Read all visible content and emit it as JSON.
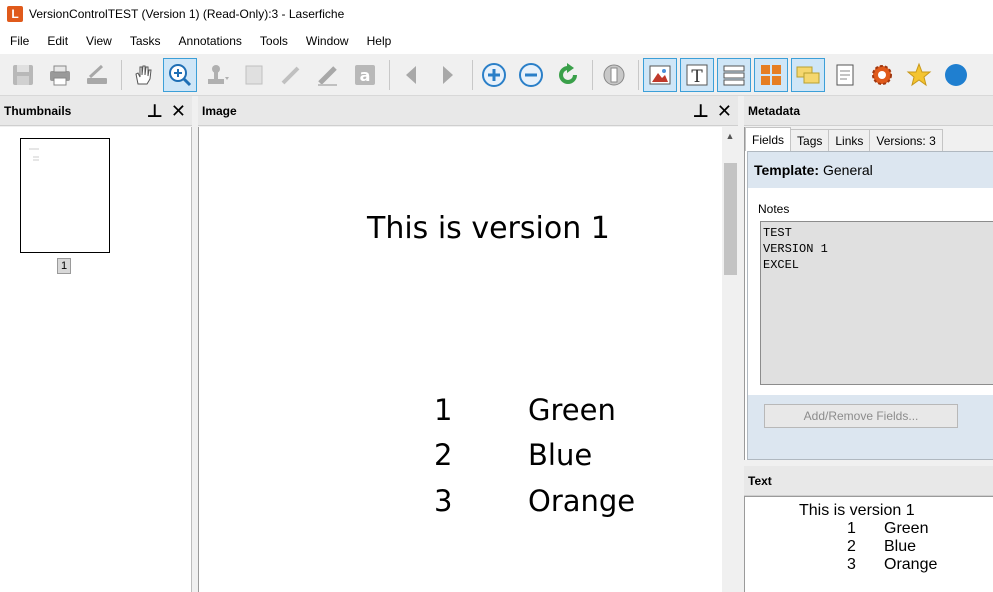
{
  "window": {
    "title": "VersionControlTEST (Version 1) (Read-Only):3 - Laserfiche",
    "app_icon_letter": "L"
  },
  "menu": [
    "File",
    "Edit",
    "View",
    "Tasks",
    "Annotations",
    "Tools",
    "Window",
    "Help"
  ],
  "toolbar": {
    "icons": [
      "save-icon",
      "print-icon",
      "scanner-icon",
      "pan-hand-icon",
      "zoom-marquee-icon",
      "stamp-icon",
      "sticky-note-icon",
      "pen-icon",
      "highlighter-icon",
      "text-box-icon",
      "previous-page-icon",
      "next-page-icon",
      "zoom-in-icon",
      "zoom-out-icon",
      "refresh-icon",
      "thumbnail-view-icon",
      "image-pane-icon",
      "text-pane-icon",
      "metadata-pane-icon",
      "thumbnails-pane-icon",
      "annotations-pane-icon",
      "document-properties-icon",
      "settings-icon",
      "favorites-star-icon",
      "help-icon"
    ]
  },
  "thumbnails": {
    "header": "Thumbnails",
    "page_number": "1"
  },
  "image": {
    "header": "Image",
    "title": "This is version 1",
    "rows": [
      {
        "num": "1",
        "label": "Green"
      },
      {
        "num": "2",
        "label": "Blue"
      },
      {
        "num": "3",
        "label": "Orange"
      }
    ]
  },
  "metadata": {
    "header": "Metadata",
    "tabs": [
      "Fields",
      "Tags",
      "Links",
      "Versions: 3"
    ],
    "template_label": "Template:",
    "template_value": "General",
    "notes_label": "Notes",
    "notes_value": "TEST\nVERSION 1\nEXCEL",
    "add_remove_button": "Add/Remove Fields..."
  },
  "text_panel": {
    "header": "Text",
    "title": "This is version 1",
    "rows": [
      {
        "num": "1",
        "label": "Green"
      },
      {
        "num": "2",
        "label": "Blue"
      },
      {
        "num": "3",
        "label": "Orange"
      }
    ]
  },
  "colors": {
    "accent": "#3c9fd8",
    "app_icon": "#e05a1b",
    "pane_bg": "#dce6f0"
  }
}
